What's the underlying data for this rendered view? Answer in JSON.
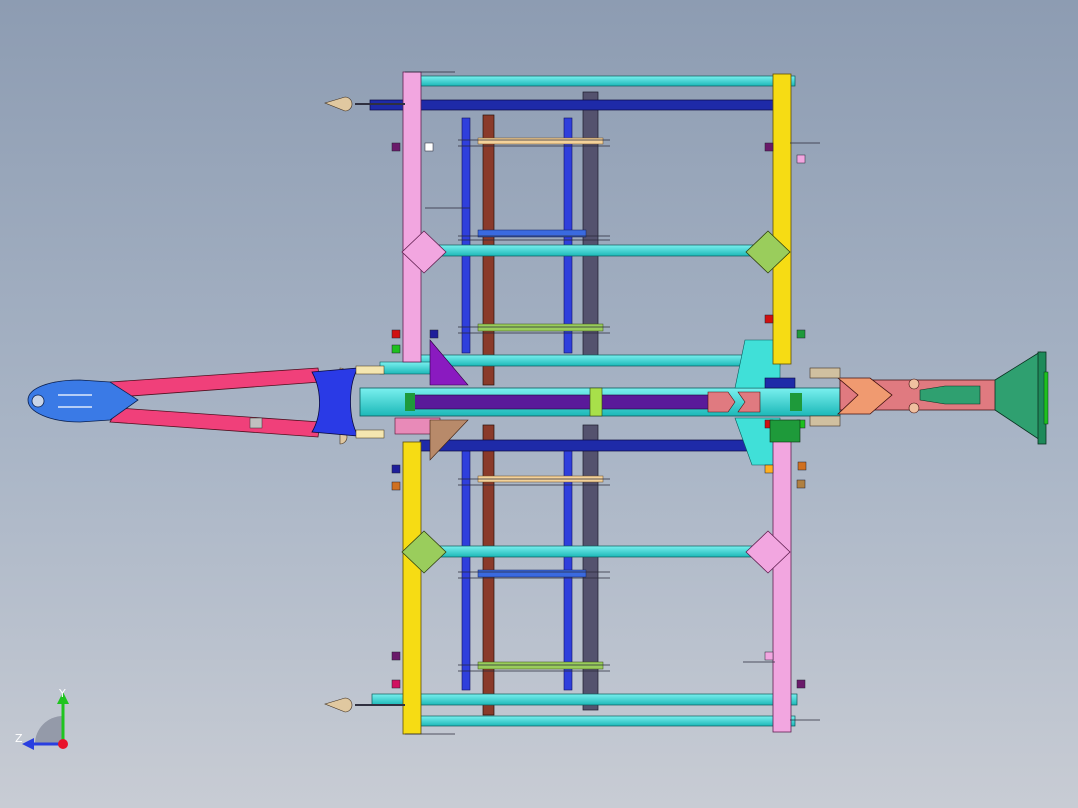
{
  "viewport": {
    "background_top": "#8d9cb2",
    "background_bottom": "#c8ccd4"
  },
  "triad": {
    "y_label": "Y",
    "z_label": "Z",
    "y_color": "#1fc41f",
    "z_color": "#2a3fe0",
    "origin_color": "#e8122a"
  },
  "palette": {
    "frame_pink": "#f2a6e0",
    "frame_yellow": "#f6dc14",
    "cross_cyan": "#2fd7d6",
    "navy": "#1e2aa8",
    "brown": "#8a3a2a",
    "slate": "#54526e",
    "tow_bar": "#f0407a",
    "hitch_blue": "#3a7ae6",
    "green_plate": "#2fa070",
    "gusset_olive": "#9acd5c",
    "salmon": "#e07a80",
    "purple": "#6a1aa0"
  }
}
